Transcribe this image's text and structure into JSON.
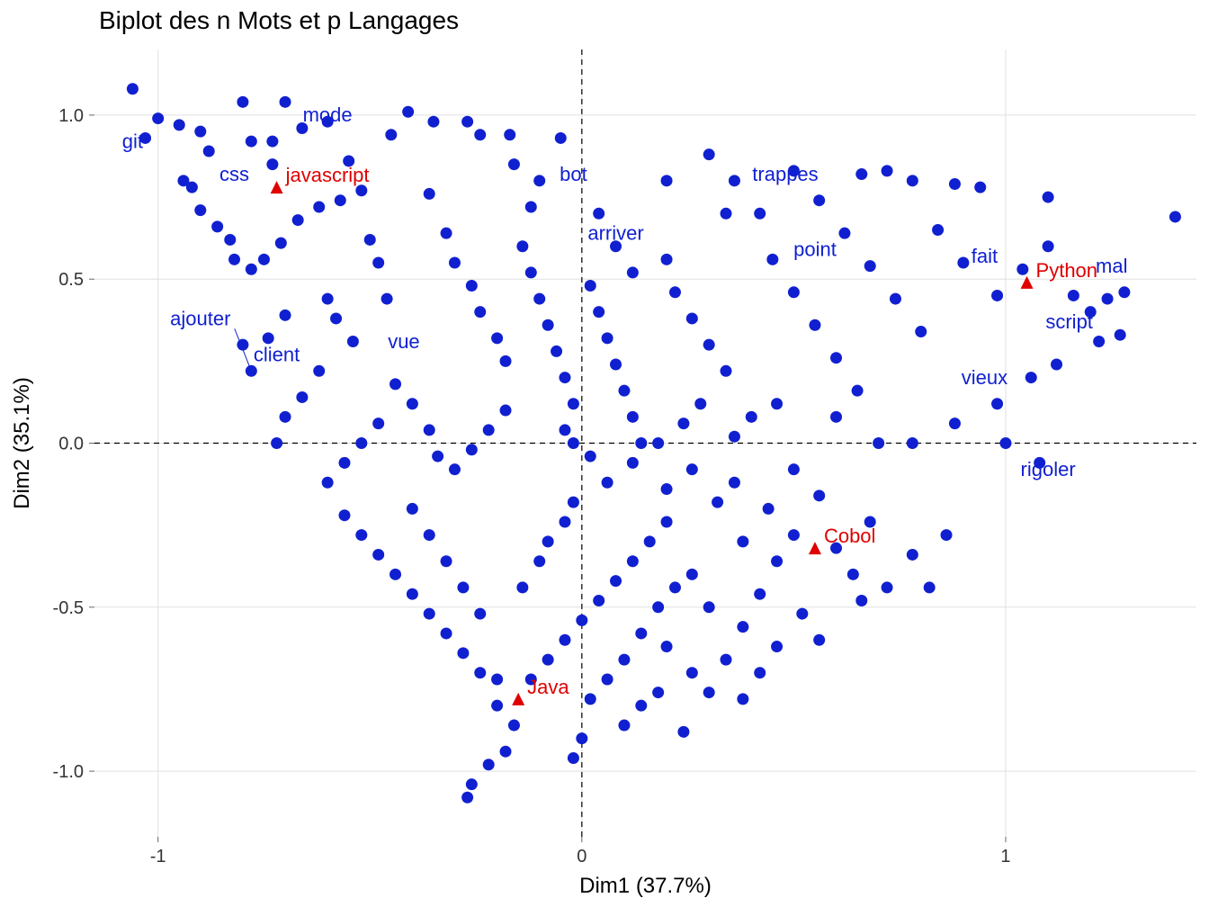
{
  "chart_data": {
    "type": "scatter",
    "title": "Biplot des n Mots et  p Langages",
    "xlabel": "Dim1 (37.7%)",
    "ylabel": "Dim2 (35.1%)",
    "xlim": [
      -1.15,
      1.45
    ],
    "ylim": [
      -1.2,
      1.2
    ],
    "xticks": [
      -1,
      0,
      1
    ],
    "yticks": [
      -1.0,
      -0.5,
      0.0,
      0.5,
      1.0
    ],
    "languages": [
      {
        "name": "javascript",
        "x": -0.72,
        "y": 0.78
      },
      {
        "name": "Python",
        "x": 1.05,
        "y": 0.49
      },
      {
        "name": "Cobol",
        "x": 0.55,
        "y": -0.32
      },
      {
        "name": "Java",
        "x": -0.15,
        "y": -0.78
      }
    ],
    "word_labels": [
      {
        "name": "git",
        "x": -1.06,
        "y": 0.9
      },
      {
        "name": "css",
        "x": -0.82,
        "y": 0.8
      },
      {
        "name": "mode",
        "x": -0.6,
        "y": 0.98
      },
      {
        "name": "bot",
        "x": -0.02,
        "y": 0.8
      },
      {
        "name": "trappes",
        "x": 0.48,
        "y": 0.8
      },
      {
        "name": "arriver",
        "x": 0.08,
        "y": 0.62
      },
      {
        "name": "point",
        "x": 0.55,
        "y": 0.57
      },
      {
        "name": "fait",
        "x": 0.95,
        "y": 0.55
      },
      {
        "name": "mal",
        "x": 1.25,
        "y": 0.52
      },
      {
        "name": "script",
        "x": 1.15,
        "y": 0.35
      },
      {
        "name": "ajouter",
        "x": -0.9,
        "y": 0.36
      },
      {
        "name": "client",
        "x": -0.72,
        "y": 0.25
      },
      {
        "name": "vue",
        "x": -0.42,
        "y": 0.29
      },
      {
        "name": "vieux",
        "x": 0.95,
        "y": 0.18
      },
      {
        "name": "rigoler",
        "x": 1.1,
        "y": -0.1
      }
    ],
    "points": [
      {
        "x": -1.06,
        "y": 1.08
      },
      {
        "x": -1.0,
        "y": 0.99
      },
      {
        "x": -0.95,
        "y": 0.97
      },
      {
        "x": -1.03,
        "y": 0.93
      },
      {
        "x": -0.9,
        "y": 0.95
      },
      {
        "x": -0.88,
        "y": 0.89
      },
      {
        "x": -0.8,
        "y": 1.04
      },
      {
        "x": -0.78,
        "y": 0.92
      },
      {
        "x": -0.73,
        "y": 0.92
      },
      {
        "x": -0.73,
        "y": 0.85
      },
      {
        "x": -0.7,
        "y": 1.04
      },
      {
        "x": -0.66,
        "y": 0.96
      },
      {
        "x": -0.6,
        "y": 0.98
      },
      {
        "x": -0.55,
        "y": 0.86
      },
      {
        "x": -0.45,
        "y": 0.94
      },
      {
        "x": -0.41,
        "y": 1.01
      },
      {
        "x": -0.35,
        "y": 0.98
      },
      {
        "x": -0.27,
        "y": 0.98
      },
      {
        "x": -0.24,
        "y": 0.94
      },
      {
        "x": -0.17,
        "y": 0.94
      },
      {
        "x": -0.05,
        "y": 0.93
      },
      {
        "x": -0.94,
        "y": 0.8
      },
      {
        "x": -0.92,
        "y": 0.78
      },
      {
        "x": -0.9,
        "y": 0.71
      },
      {
        "x": -0.86,
        "y": 0.66
      },
      {
        "x": -0.83,
        "y": 0.62
      },
      {
        "x": -0.82,
        "y": 0.56
      },
      {
        "x": -0.78,
        "y": 0.53
      },
      {
        "x": -0.75,
        "y": 0.56
      },
      {
        "x": -0.71,
        "y": 0.61
      },
      {
        "x": -0.67,
        "y": 0.68
      },
      {
        "x": -0.62,
        "y": 0.72
      },
      {
        "x": -0.57,
        "y": 0.74
      },
      {
        "x": -0.52,
        "y": 0.77
      },
      {
        "x": -0.5,
        "y": 0.62
      },
      {
        "x": -0.48,
        "y": 0.55
      },
      {
        "x": -0.46,
        "y": 0.44
      },
      {
        "x": -0.6,
        "y": 0.44
      },
      {
        "x": -0.58,
        "y": 0.38
      },
      {
        "x": -0.54,
        "y": 0.31
      },
      {
        "x": -0.7,
        "y": 0.39
      },
      {
        "x": -0.74,
        "y": 0.32
      },
      {
        "x": -0.8,
        "y": 0.3
      },
      {
        "x": -0.78,
        "y": 0.22
      },
      {
        "x": -0.36,
        "y": 0.76
      },
      {
        "x": -0.32,
        "y": 0.64
      },
      {
        "x": -0.3,
        "y": 0.55
      },
      {
        "x": -0.26,
        "y": 0.48
      },
      {
        "x": -0.24,
        "y": 0.4
      },
      {
        "x": -0.2,
        "y": 0.32
      },
      {
        "x": -0.18,
        "y": 0.25
      },
      {
        "x": -0.14,
        "y": 0.6
      },
      {
        "x": -0.12,
        "y": 0.52
      },
      {
        "x": -0.1,
        "y": 0.44
      },
      {
        "x": -0.08,
        "y": 0.36
      },
      {
        "x": -0.06,
        "y": 0.28
      },
      {
        "x": -0.04,
        "y": 0.2
      },
      {
        "x": -0.02,
        "y": 0.12
      },
      {
        "x": -0.1,
        "y": 0.8
      },
      {
        "x": -0.12,
        "y": 0.72
      },
      {
        "x": -0.16,
        "y": 0.85
      },
      {
        "x": 0.02,
        "y": 0.48
      },
      {
        "x": 0.04,
        "y": 0.4
      },
      {
        "x": 0.06,
        "y": 0.32
      },
      {
        "x": 0.08,
        "y": 0.24
      },
      {
        "x": 0.1,
        "y": 0.16
      },
      {
        "x": 0.12,
        "y": 0.08
      },
      {
        "x": 0.14,
        "y": 0.0
      },
      {
        "x": 0.04,
        "y": 0.7
      },
      {
        "x": 0.08,
        "y": 0.6
      },
      {
        "x": 0.12,
        "y": 0.52
      },
      {
        "x": 0.2,
        "y": 0.56
      },
      {
        "x": 0.22,
        "y": 0.46
      },
      {
        "x": 0.26,
        "y": 0.38
      },
      {
        "x": 0.3,
        "y": 0.3
      },
      {
        "x": 0.34,
        "y": 0.22
      },
      {
        "x": 0.3,
        "y": 0.88
      },
      {
        "x": 0.36,
        "y": 0.8
      },
      {
        "x": 0.42,
        "y": 0.7
      },
      {
        "x": 0.45,
        "y": 0.56
      },
      {
        "x": 0.5,
        "y": 0.46
      },
      {
        "x": 0.55,
        "y": 0.36
      },
      {
        "x": 0.6,
        "y": 0.26
      },
      {
        "x": 0.65,
        "y": 0.16
      },
      {
        "x": 0.5,
        "y": 0.83
      },
      {
        "x": 0.56,
        "y": 0.74
      },
      {
        "x": 0.62,
        "y": 0.64
      },
      {
        "x": 0.68,
        "y": 0.54
      },
      {
        "x": 0.74,
        "y": 0.44
      },
      {
        "x": 0.8,
        "y": 0.34
      },
      {
        "x": 0.66,
        "y": 0.82
      },
      {
        "x": 0.72,
        "y": 0.83
      },
      {
        "x": 0.78,
        "y": 0.8
      },
      {
        "x": 0.88,
        "y": 0.79
      },
      {
        "x": 0.94,
        "y": 0.78
      },
      {
        "x": 0.84,
        "y": 0.65
      },
      {
        "x": 0.9,
        "y": 0.55
      },
      {
        "x": 0.98,
        "y": 0.45
      },
      {
        "x": 1.04,
        "y": 0.53
      },
      {
        "x": 1.1,
        "y": 0.6
      },
      {
        "x": 1.16,
        "y": 0.45
      },
      {
        "x": 1.2,
        "y": 0.4
      },
      {
        "x": 1.24,
        "y": 0.44
      },
      {
        "x": 1.28,
        "y": 0.46
      },
      {
        "x": 1.27,
        "y": 0.33
      },
      {
        "x": 1.22,
        "y": 0.31
      },
      {
        "x": 1.12,
        "y": 0.24
      },
      {
        "x": 1.06,
        "y": 0.2
      },
      {
        "x": 0.98,
        "y": 0.12
      },
      {
        "x": 0.88,
        "y": 0.06
      },
      {
        "x": 0.78,
        "y": 0.0
      },
      {
        "x": 1.1,
        "y": 0.75
      },
      {
        "x": 1.0,
        "y": 0.0
      },
      {
        "x": 1.08,
        "y": -0.06
      },
      {
        "x": 0.46,
        "y": 0.12
      },
      {
        "x": 0.4,
        "y": 0.08
      },
      {
        "x": 0.36,
        "y": 0.02
      },
      {
        "x": 0.28,
        "y": 0.12
      },
      {
        "x": 0.24,
        "y": 0.06
      },
      {
        "x": 0.18,
        "y": 0.0
      },
      {
        "x": 0.12,
        "y": -0.06
      },
      {
        "x": 0.06,
        "y": -0.12
      },
      {
        "x": 0.02,
        "y": -0.04
      },
      {
        "x": -0.02,
        "y": -0.18
      },
      {
        "x": -0.04,
        "y": -0.24
      },
      {
        "x": -0.08,
        "y": -0.3
      },
      {
        "x": -0.1,
        "y": -0.36
      },
      {
        "x": -0.14,
        "y": -0.44
      },
      {
        "x": -0.04,
        "y": 0.04
      },
      {
        "x": -0.02,
        "y": 0.0
      },
      {
        "x": -0.18,
        "y": 0.1
      },
      {
        "x": -0.22,
        "y": 0.04
      },
      {
        "x": -0.26,
        "y": -0.02
      },
      {
        "x": -0.3,
        "y": -0.08
      },
      {
        "x": -0.34,
        "y": -0.04
      },
      {
        "x": -0.36,
        "y": 0.04
      },
      {
        "x": -0.4,
        "y": 0.12
      },
      {
        "x": -0.44,
        "y": 0.18
      },
      {
        "x": -0.48,
        "y": 0.06
      },
      {
        "x": -0.52,
        "y": 0.0
      },
      {
        "x": -0.56,
        "y": -0.06
      },
      {
        "x": -0.6,
        "y": -0.12
      },
      {
        "x": -0.62,
        "y": 0.22
      },
      {
        "x": -0.66,
        "y": 0.14
      },
      {
        "x": -0.7,
        "y": 0.08
      },
      {
        "x": -0.72,
        "y": 0.0
      },
      {
        "x": -0.56,
        "y": -0.22
      },
      {
        "x": -0.52,
        "y": -0.28
      },
      {
        "x": -0.48,
        "y": -0.34
      },
      {
        "x": -0.44,
        "y": -0.4
      },
      {
        "x": -0.4,
        "y": -0.46
      },
      {
        "x": -0.36,
        "y": -0.52
      },
      {
        "x": -0.32,
        "y": -0.58
      },
      {
        "x": -0.28,
        "y": -0.64
      },
      {
        "x": -0.24,
        "y": -0.7
      },
      {
        "x": -0.2,
        "y": -0.72
      },
      {
        "x": -0.4,
        "y": -0.2
      },
      {
        "x": -0.36,
        "y": -0.28
      },
      {
        "x": -0.32,
        "y": -0.36
      },
      {
        "x": -0.28,
        "y": -0.44
      },
      {
        "x": -0.24,
        "y": -0.52
      },
      {
        "x": -0.2,
        "y": -0.8
      },
      {
        "x": -0.16,
        "y": -0.86
      },
      {
        "x": -0.18,
        "y": -0.94
      },
      {
        "x": -0.22,
        "y": -0.98
      },
      {
        "x": -0.26,
        "y": -1.04
      },
      {
        "x": -0.27,
        "y": -1.08
      },
      {
        "x": -0.12,
        "y": -0.72
      },
      {
        "x": -0.08,
        "y": -0.66
      },
      {
        "x": -0.04,
        "y": -0.6
      },
      {
        "x": 0.0,
        "y": -0.54
      },
      {
        "x": 0.04,
        "y": -0.48
      },
      {
        "x": 0.08,
        "y": -0.42
      },
      {
        "x": 0.12,
        "y": -0.36
      },
      {
        "x": 0.16,
        "y": -0.3
      },
      {
        "x": 0.2,
        "y": -0.24
      },
      {
        "x": 0.0,
        "y": -0.9
      },
      {
        "x": -0.02,
        "y": -0.96
      },
      {
        "x": 0.02,
        "y": -0.78
      },
      {
        "x": 0.06,
        "y": -0.72
      },
      {
        "x": 0.1,
        "y": -0.66
      },
      {
        "x": 0.14,
        "y": -0.58
      },
      {
        "x": 0.18,
        "y": -0.5
      },
      {
        "x": 0.22,
        "y": -0.44
      },
      {
        "x": 0.1,
        "y": -0.86
      },
      {
        "x": 0.14,
        "y": -0.8
      },
      {
        "x": 0.18,
        "y": -0.76
      },
      {
        "x": 0.24,
        "y": -0.88
      },
      {
        "x": 0.3,
        "y": -0.76
      },
      {
        "x": 0.34,
        "y": -0.66
      },
      {
        "x": 0.38,
        "y": -0.56
      },
      {
        "x": 0.42,
        "y": -0.46
      },
      {
        "x": 0.46,
        "y": -0.36
      },
      {
        "x": 0.5,
        "y": -0.28
      },
      {
        "x": 0.2,
        "y": -0.14
      },
      {
        "x": 0.26,
        "y": -0.08
      },
      {
        "x": 0.32,
        "y": -0.18
      },
      {
        "x": 0.36,
        "y": -0.12
      },
      {
        "x": 0.44,
        "y": -0.2
      },
      {
        "x": 0.38,
        "y": -0.3
      },
      {
        "x": 0.26,
        "y": -0.4
      },
      {
        "x": 0.3,
        "y": -0.5
      },
      {
        "x": 0.2,
        "y": -0.62
      },
      {
        "x": 0.5,
        "y": -0.08
      },
      {
        "x": 0.56,
        "y": -0.16
      },
      {
        "x": 0.6,
        "y": -0.32
      },
      {
        "x": 0.64,
        "y": -0.4
      },
      {
        "x": 0.68,
        "y": -0.24
      },
      {
        "x": 0.72,
        "y": -0.44
      },
      {
        "x": 0.78,
        "y": -0.34
      },
      {
        "x": 0.82,
        "y": -0.44
      },
      {
        "x": 0.86,
        "y": -0.28
      },
      {
        "x": 0.66,
        "y": -0.48
      },
      {
        "x": 0.7,
        "y": 0.0
      },
      {
        "x": 0.6,
        "y": 0.08
      },
      {
        "x": 0.46,
        "y": -0.62
      },
      {
        "x": 0.42,
        "y": -0.7
      },
      {
        "x": 0.38,
        "y": -0.78
      },
      {
        "x": 0.52,
        "y": -0.52
      },
      {
        "x": 0.56,
        "y": -0.6
      },
      {
        "x": 0.26,
        "y": -0.7
      },
      {
        "x": 0.34,
        "y": 0.7
      },
      {
        "x": 0.2,
        "y": 0.8
      },
      {
        "x": 1.4,
        "y": 0.69
      }
    ]
  }
}
